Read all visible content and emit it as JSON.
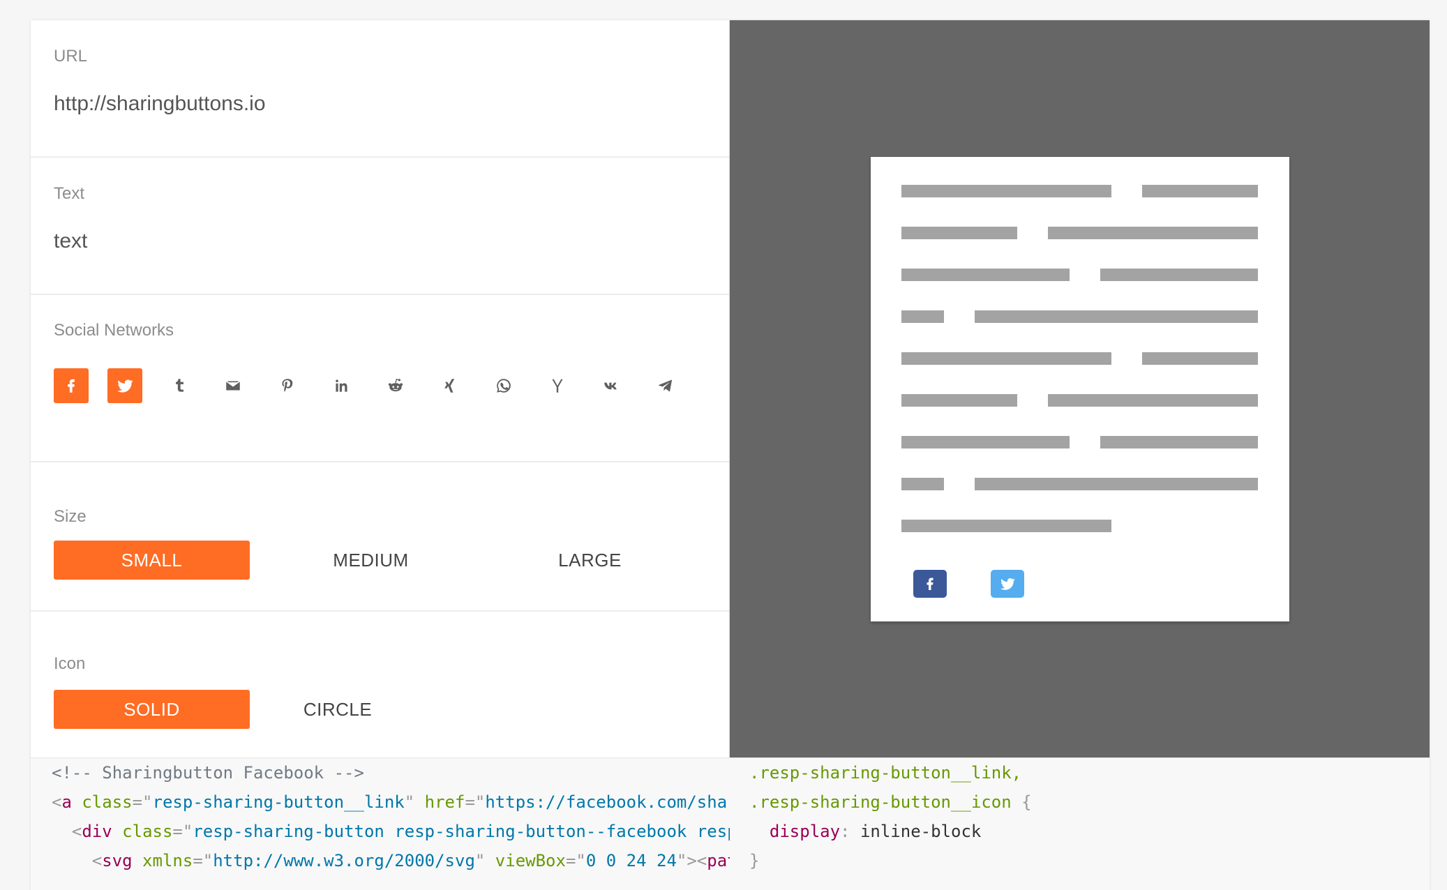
{
  "url_section": {
    "label": "URL",
    "value": "http://sharingbuttons.io"
  },
  "text_section": {
    "label": "Text",
    "value": "text"
  },
  "social_section": {
    "label": "Social Networks",
    "networks": [
      {
        "name": "facebook",
        "icon": "facebook-icon",
        "active": true
      },
      {
        "name": "twitter",
        "icon": "twitter-icon",
        "active": true
      },
      {
        "name": "tumblr",
        "icon": "tumblr-icon",
        "active": false
      },
      {
        "name": "email",
        "icon": "email-icon",
        "active": false
      },
      {
        "name": "pinterest",
        "icon": "pinterest-icon",
        "active": false
      },
      {
        "name": "linkedin",
        "icon": "linkedin-icon",
        "active": false
      },
      {
        "name": "reddit",
        "icon": "reddit-icon",
        "active": false
      },
      {
        "name": "xing",
        "icon": "xing-icon",
        "active": false
      },
      {
        "name": "whatsapp",
        "icon": "whatsapp-icon",
        "active": false
      },
      {
        "name": "hackernews",
        "icon": "hackernews-icon",
        "active": false
      },
      {
        "name": "vk",
        "icon": "vk-icon",
        "active": false
      },
      {
        "name": "telegram",
        "icon": "telegram-icon",
        "active": false
      }
    ]
  },
  "size_section": {
    "label": "Size",
    "options": [
      {
        "label": "SMALL",
        "active": true
      },
      {
        "label": "MEDIUM",
        "active": false
      },
      {
        "label": "LARGE",
        "active": false
      }
    ]
  },
  "icon_section": {
    "label": "Icon",
    "options": [
      {
        "label": "SOLID",
        "active": true
      },
      {
        "label": "CIRCLE",
        "active": false
      }
    ]
  },
  "preview": {
    "buttons": [
      {
        "name": "facebook",
        "icon": "facebook-icon",
        "color": "#3b5998"
      },
      {
        "name": "twitter",
        "icon": "twitter-icon",
        "color": "#55acee"
      }
    ]
  },
  "code": {
    "html_lines": [
      {
        "parts": [
          {
            "t": "<!-- Sharingbutton Facebook -->",
            "c": "c-comment"
          }
        ]
      },
      {
        "parts": [
          {
            "t": "<",
            "c": "c-punc"
          },
          {
            "t": "a",
            "c": "c-tag"
          },
          {
            "t": " class",
            "c": "c-attr"
          },
          {
            "t": "=\"",
            "c": "c-punc"
          },
          {
            "t": "resp-sharing-button__link",
            "c": "c-str"
          },
          {
            "t": "\"",
            "c": "c-punc"
          },
          {
            "t": " href",
            "c": "c-attr"
          },
          {
            "t": "=\"",
            "c": "c-punc"
          },
          {
            "t": "https://facebook.com/shar",
            "c": "c-str"
          }
        ]
      },
      {
        "parts": [
          {
            "t": "  <",
            "c": "c-punc"
          },
          {
            "t": "div",
            "c": "c-tag"
          },
          {
            "t": " class",
            "c": "c-attr"
          },
          {
            "t": "=\"",
            "c": "c-punc"
          },
          {
            "t": "resp-sharing-button resp-sharing-button--facebook resp",
            "c": "c-str"
          }
        ]
      },
      {
        "parts": [
          {
            "t": "    <",
            "c": "c-punc"
          },
          {
            "t": "svg",
            "c": "c-tag"
          },
          {
            "t": " xmlns",
            "c": "c-attr"
          },
          {
            "t": "=\"",
            "c": "c-punc"
          },
          {
            "t": "http://www.w3.org/2000/svg",
            "c": "c-str"
          },
          {
            "t": "\"",
            "c": "c-punc"
          },
          {
            "t": " viewBox",
            "c": "c-attr"
          },
          {
            "t": "=\"",
            "c": "c-punc"
          },
          {
            "t": "0 0 24 24",
            "c": "c-str"
          },
          {
            "t": "\"><",
            "c": "c-punc"
          },
          {
            "t": "pat",
            "c": "c-tag"
          }
        ]
      }
    ],
    "css_lines": [
      {
        "parts": [
          {
            "t": ".resp-sharing-button__link,",
            "c": "c-sel"
          }
        ]
      },
      {
        "parts": [
          {
            "t": ".resp-sharing-button__icon",
            "c": "c-sel"
          },
          {
            "t": " {",
            "c": "c-punc"
          }
        ]
      },
      {
        "parts": [
          {
            "t": "  display",
            "c": "c-prop"
          },
          {
            "t": ": ",
            "c": "c-punc"
          },
          {
            "t": "inline-block",
            "c": "c-text"
          }
        ]
      },
      {
        "parts": [
          {
            "t": "}",
            "c": "c-punc"
          }
        ]
      }
    ]
  },
  "colors": {
    "accent": "#ff6c23",
    "preview_bg": "#666666",
    "facebook": "#3b5998",
    "twitter": "#55acee"
  }
}
